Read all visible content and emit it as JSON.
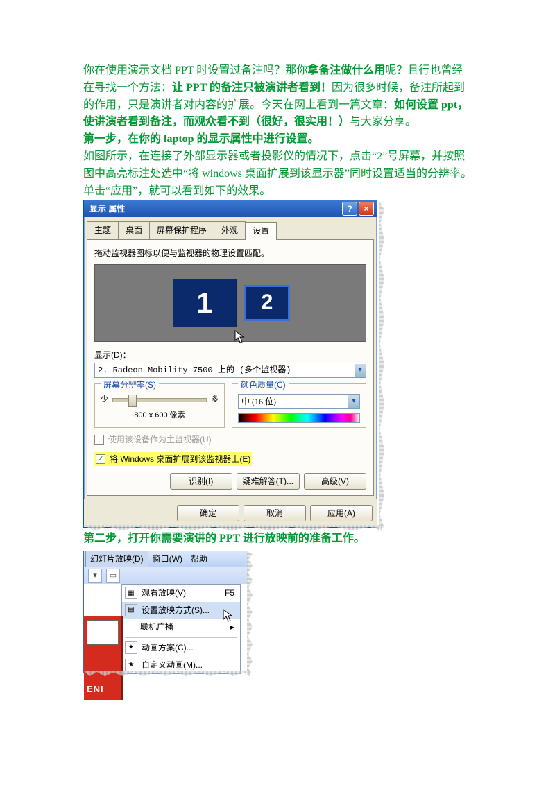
{
  "article": {
    "p1a": "你在使用演示文档 PPT 时设置过备注吗？那你",
    "p1b": "拿备注做什么用",
    "p1c": "呢？且行也曾经在寻找一个方法：",
    "p1d": "让 PPT 的备注只被演讲者看到！",
    "p1e": "因为很多时候，备注所起到的作用，只是演讲者对内容的扩展。今天在网上看到一篇文章：",
    "p1f": "如何设置 ppt，使讲演者看到备注，而观众看不到（很好，很实用！）",
    "p1g": "与大家分享。",
    "step1": "第一步，在你的 laptop 的显示属性中进行设置。",
    "p2": "如图所示，在连接了外部显示器或者投影仪的情况下，点击“2”号屏幕，并按照图中高亮标注处选中“将 windows 桌面扩展到该显示器”同时设置适当的分辨率。",
    "p3": "单击“应用”，就可以看到如下的效果。",
    "step2": "第二步，打开你需要演讲的 PPT 进行放映前的准备工作。"
  },
  "dlg": {
    "title": "显示 属性",
    "tabs": [
      "主题",
      "桌面",
      "屏幕保护程序",
      "外观",
      "设置"
    ],
    "instr": "拖动监视器图标以便与监视器的物理设置匹配。",
    "mon1": "1",
    "mon2": "2",
    "display_label": "显示(D)：",
    "display_value": "2. Radeon Mobility 7500 上的 (多个监视器)",
    "res_legend": "屏幕分辨率(S)",
    "res_min": "少",
    "res_max": "多",
    "res_value": "800 x 600 像素",
    "color_legend": "颜色质量(C)",
    "color_value": "中 (16 位)",
    "chk_primary": "使用该设备作为主监视器(U)",
    "chk_extend": "将 Windows 桌面扩展到该监视器上(E)",
    "btn_identify": "识别(I)",
    "btn_trouble": "疑难解答(T)...",
    "btn_adv": "高级(V)",
    "btn_ok": "确定",
    "btn_cancel": "取消",
    "btn_apply": "应用(A)"
  },
  "ss": {
    "menu_slideshow": "幻灯片放映(D)",
    "menu_window": "窗口(W)",
    "menu_help": "帮助",
    "f5": "F5",
    "brand": "ENI",
    "items": {
      "view": "观看放映(V)",
      "setup": "设置放映方式(S)...",
      "broadcast": "联机广播",
      "scheme": "动画方案(C)...",
      "custom": "自定义动画(M)..."
    }
  }
}
